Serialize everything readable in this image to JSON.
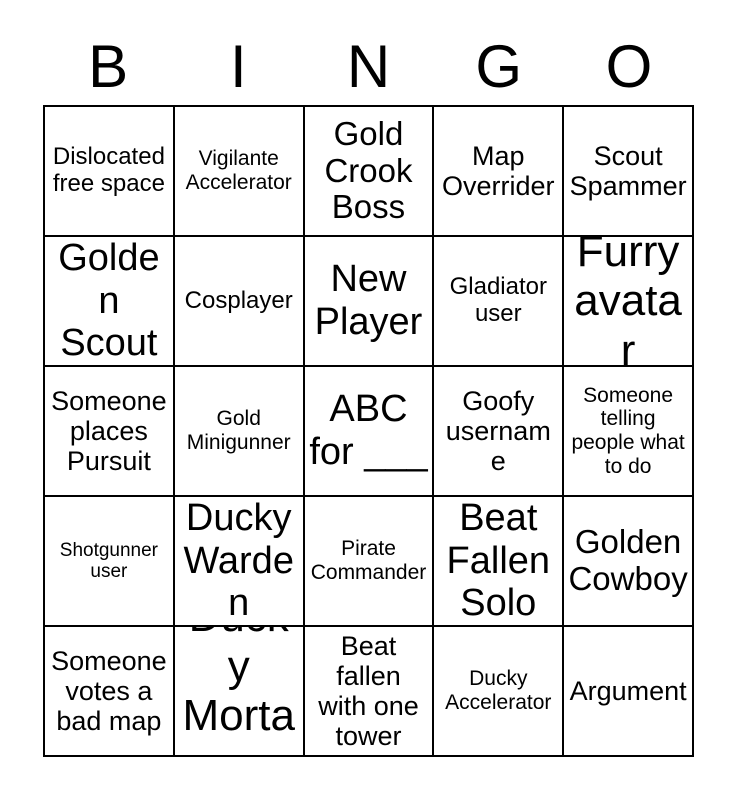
{
  "card": {
    "header_letters": [
      "B",
      "I",
      "N",
      "G",
      "O"
    ],
    "columns": 5,
    "rows": 5,
    "border_color": "#000000",
    "background_color": "#ffffff",
    "text_color": "#000000",
    "cells": [
      {
        "text": "Dislocated free space",
        "size": "m"
      },
      {
        "text": "Vigilante Accelerator",
        "size": "s"
      },
      {
        "text": "Gold Crook Boss",
        "size": "xl"
      },
      {
        "text": "Map Overrider",
        "size": "l"
      },
      {
        "text": "Scout Spammer",
        "size": "l"
      },
      {
        "text": "Golden Scout",
        "size": "xxl"
      },
      {
        "text": "Cosplayer",
        "size": "m"
      },
      {
        "text": "New Player",
        "size": "xxl"
      },
      {
        "text": "Gladiator user",
        "size": "m"
      },
      {
        "text": "Furry avatar",
        "size": "xxxl"
      },
      {
        "text": "Someone places Pursuit",
        "size": "l"
      },
      {
        "text": "Gold Minigunner",
        "size": "s"
      },
      {
        "text": "ABC for ___",
        "size": "xxl"
      },
      {
        "text": "Goofy username",
        "size": "l"
      },
      {
        "text": "Someone telling people what to do",
        "size": "s"
      },
      {
        "text": "Shotgunner user",
        "size": "xs"
      },
      {
        "text": "Ducky Warden",
        "size": "xxl"
      },
      {
        "text": "Pirate Commander",
        "size": "s"
      },
      {
        "text": "Beat Fallen Solo",
        "size": "xxl"
      },
      {
        "text": "Golden Cowboy",
        "size": "xl"
      },
      {
        "text": "Someone votes a bad map",
        "size": "l"
      },
      {
        "text": "Ducky Mortar",
        "size": "xxxl"
      },
      {
        "text": "Beat fallen with one tower",
        "size": "l"
      },
      {
        "text": "Ducky Accelerator",
        "size": "s"
      },
      {
        "text": "Argument",
        "size": "l"
      }
    ]
  }
}
